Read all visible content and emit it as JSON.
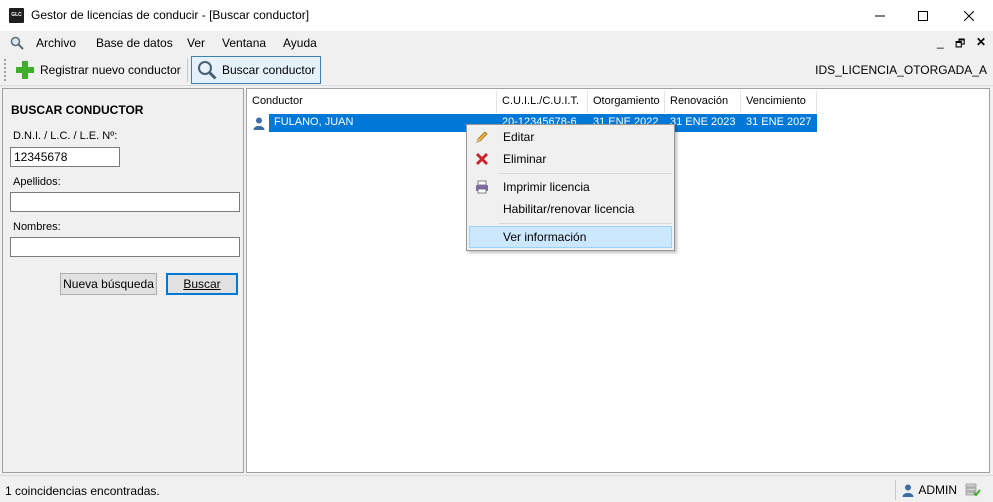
{
  "window": {
    "title": "Gestor de licencias de conducir - [Buscar conductor]",
    "app_icon_text": "GLC"
  },
  "menu": {
    "items": [
      "Archivo",
      "Base de datos",
      "Ver",
      "Ventana",
      "Ayuda"
    ]
  },
  "toolbar": {
    "register_label": "Registrar nuevo conductor",
    "search_label": "Buscar conductor",
    "right_label": "IDS_LICENCIA_OTORGADA_A"
  },
  "search_panel": {
    "title": "BUSCAR CONDUCTOR",
    "dni_label": "D.N.I. / L.C. / L.E. Nº:",
    "dni_value": "12345678",
    "apellidos_label": "Apellidos:",
    "apellidos_value": "",
    "nombres_label": "Nombres:",
    "nombres_value": "",
    "new_search_label": "Nueva búsqueda",
    "search_button_label": "Buscar"
  },
  "results": {
    "columns": [
      "Conductor",
      "C.U.I.L./C.U.I.T.",
      "Otorgamiento",
      "Renovación",
      "Vencimiento"
    ],
    "rows": [
      {
        "conductor": "FULANO, JUAN",
        "cuil": "20-12345678-6",
        "otorgamiento": "31 ENE 2022",
        "renovacion": "31 ENE 2023",
        "vencimiento": "31 ENE 2027"
      }
    ]
  },
  "context_menu": {
    "edit": "Editar",
    "delete": "Eliminar",
    "print": "Imprimir licencia",
    "renew": "Habilitar/renovar licencia",
    "info": "Ver información"
  },
  "status": {
    "text": "1 coincidencias encontradas.",
    "user": "ADMIN"
  },
  "colors": {
    "selection": "#0078d7",
    "hover": "#cce8ff",
    "accent": "#3c7fb1"
  }
}
